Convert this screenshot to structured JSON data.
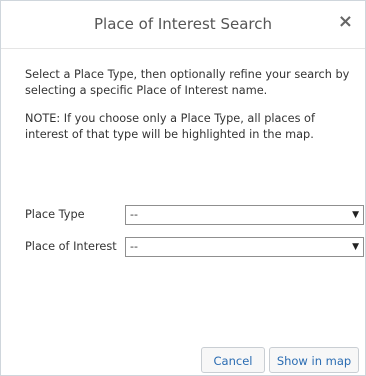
{
  "dialog": {
    "title": "Place of Interest Search",
    "close_glyph": "×",
    "intro": "Select a Place Type, then optionally refine your search by selecting a specific Place of Interest name.",
    "note": "NOTE: If you choose only a Place Type, all places of interest of that type will be highlighted in the map."
  },
  "form": {
    "place_type_label": "Place Type",
    "place_type_value": "--",
    "place_of_interest_label": "Place of Interest",
    "place_of_interest_value": "--",
    "dropdown_arrow": "▼"
  },
  "actions": {
    "cancel_label": "Cancel",
    "show_label": "Show in map"
  },
  "colors": {
    "link_blue": "#2a6cb2",
    "border": "#cfd6dc"
  }
}
